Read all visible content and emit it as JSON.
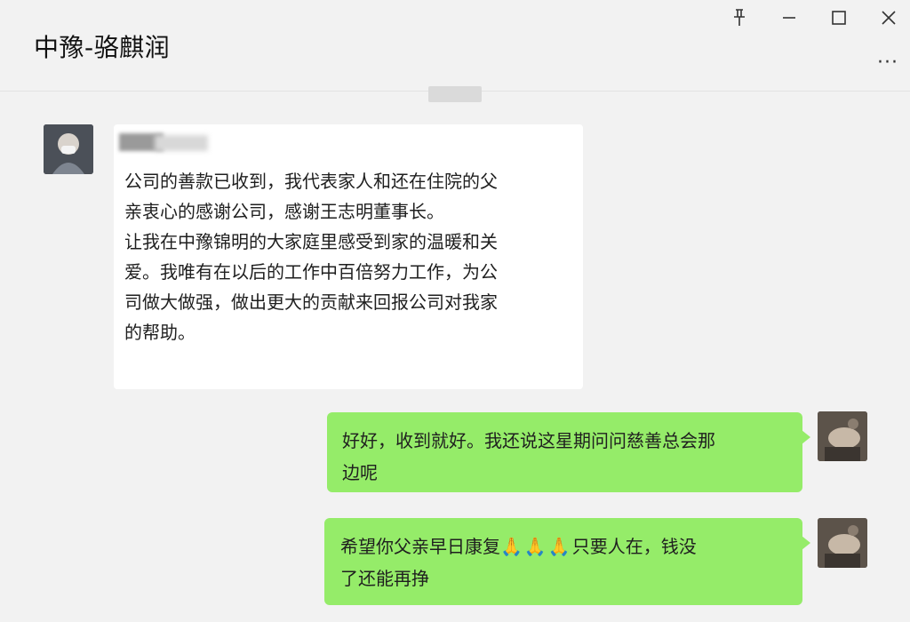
{
  "header": {
    "title": "中豫-骆麒润",
    "pin_icon": "pin-icon",
    "minimize_icon": "minimize-icon",
    "maximize_icon": "maximize-icon",
    "close_icon": "close-icon",
    "more_label": "···"
  },
  "messages": [
    {
      "side": "left",
      "sender": "",
      "text": "公司的善款已收到，我代表家人和还在住院的父\n亲衷心的感谢公司，感谢王志明董事长。\n让我在中豫锦明的大家庭里感受到家的温暖和关\n爱。我唯有在以后的工作中百倍努力工作，为公\n司做大做强，做出更大的贡献来回报公司对我家\n的帮助。"
    },
    {
      "side": "right",
      "text": "好好，收到就好。我还说这星期问问慈善总会那\n边呢"
    },
    {
      "side": "right",
      "text_before": "希望你父亲早日康复",
      "emojis": [
        "🙏",
        "🙏",
        "🙏"
      ],
      "text_after": "只要人在，钱没\n了还能再挣"
    }
  ],
  "colors": {
    "bg": "#f2f2f2",
    "bubble_white": "#ffffff",
    "bubble_green": "#95ec69"
  }
}
